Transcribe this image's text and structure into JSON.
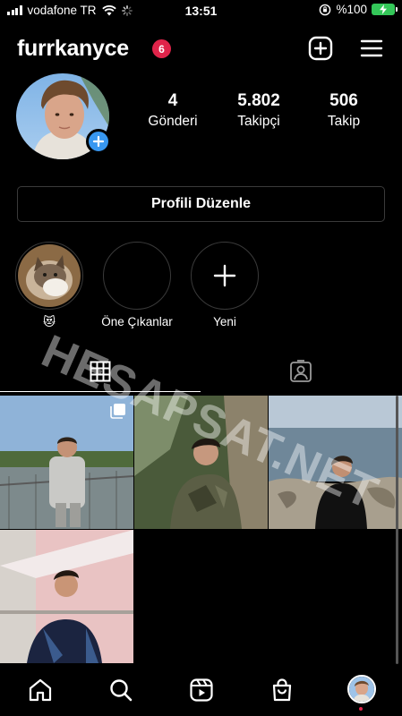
{
  "status_bar": {
    "carrier": "vodafone TR",
    "time": "13:51",
    "battery": "%100"
  },
  "header": {
    "username": "furrkanyce",
    "notification_count": "6",
    "new_post_icon": "plus-square-icon",
    "menu_icon": "hamburger-menu-icon"
  },
  "profile": {
    "stats": [
      {
        "value": "4",
        "label": "Gönderi"
      },
      {
        "value": "5.802",
        "label": "Takipçi"
      },
      {
        "value": "506",
        "label": "Takip"
      }
    ],
    "edit_button_label": "Profili Düzenle"
  },
  "highlights": [
    {
      "label": "😻"
    },
    {
      "label": "Öne Çıkanlar"
    },
    {
      "label": "Yeni"
    }
  ],
  "tabs": [
    "grid-icon",
    "tagged-icon"
  ],
  "watermark": "HESAPSAT.NET",
  "bottom_nav": [
    "home-icon",
    "search-icon",
    "reels-icon",
    "shop-icon",
    "profile-icon"
  ],
  "colors": {
    "background": "#000000",
    "badge": "#e0244a",
    "accent_blue": "#3897f0",
    "battery_green": "#34c759",
    "divider": "#3a3a3a"
  }
}
